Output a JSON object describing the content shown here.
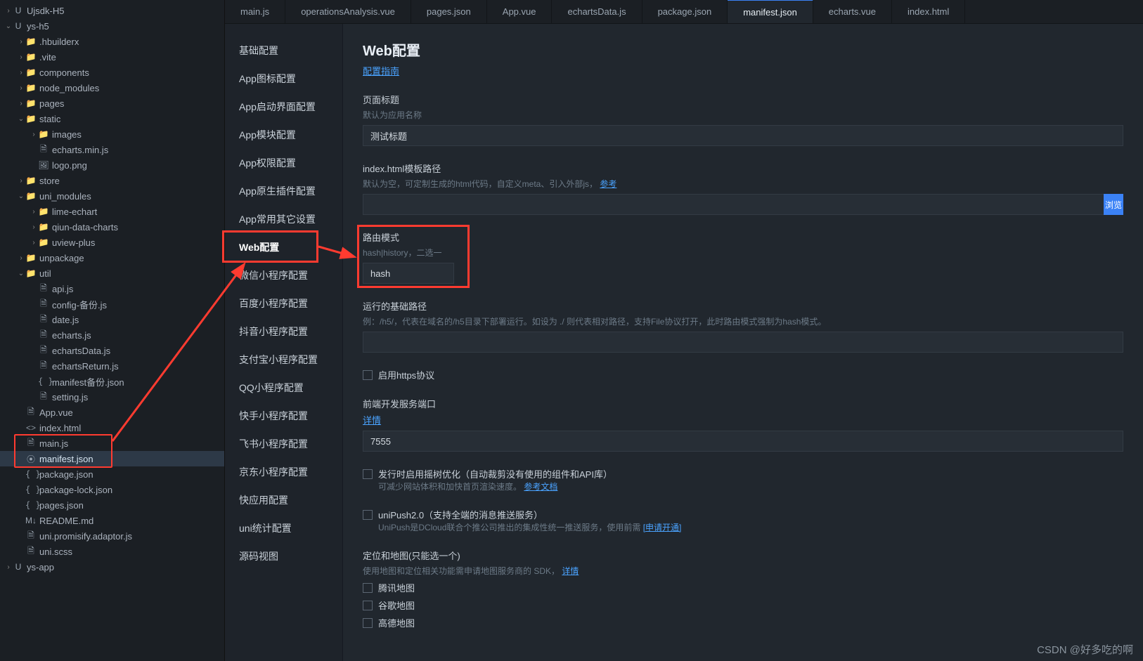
{
  "tabs": [
    {
      "label": "main.js"
    },
    {
      "label": "operationsAnalysis.vue"
    },
    {
      "label": "pages.json"
    },
    {
      "label": "App.vue"
    },
    {
      "label": "echartsData.js"
    },
    {
      "label": "package.json"
    },
    {
      "label": "manifest.json",
      "active": true
    },
    {
      "label": "echarts.vue"
    },
    {
      "label": "index.html"
    }
  ],
  "explorer": {
    "root1": "Ujsdk-H5",
    "root2": "ys-h5",
    "items": [
      {
        "pad": 1,
        "chev": ">",
        "icon": "folder",
        "label": ".hbuilderx"
      },
      {
        "pad": 1,
        "chev": ">",
        "icon": "folder",
        "label": ".vite"
      },
      {
        "pad": 1,
        "chev": ">",
        "icon": "folder",
        "label": "components"
      },
      {
        "pad": 1,
        "chev": ">",
        "icon": "folder",
        "label": "node_modules"
      },
      {
        "pad": 1,
        "chev": ">",
        "icon": "folder",
        "label": "pages"
      },
      {
        "pad": 1,
        "chev": "v",
        "icon": "folder",
        "label": "static"
      },
      {
        "pad": 2,
        "chev": ">",
        "icon": "folder",
        "label": "images"
      },
      {
        "pad": 2,
        "chev": "",
        "icon": "file",
        "label": "echarts.min.js"
      },
      {
        "pad": 2,
        "chev": "",
        "icon": "img",
        "label": "logo.png"
      },
      {
        "pad": 1,
        "chev": ">",
        "icon": "folder",
        "label": "store"
      },
      {
        "pad": 1,
        "chev": "v",
        "icon": "folder",
        "label": "uni_modules"
      },
      {
        "pad": 2,
        "chev": ">",
        "icon": "folder",
        "label": "lime-echart"
      },
      {
        "pad": 2,
        "chev": ">",
        "icon": "folder",
        "label": "qiun-data-charts"
      },
      {
        "pad": 2,
        "chev": ">",
        "icon": "folder",
        "label": "uview-plus"
      },
      {
        "pad": 1,
        "chev": ">",
        "icon": "folder",
        "label": "unpackage"
      },
      {
        "pad": 1,
        "chev": "v",
        "icon": "folder",
        "label": "util"
      },
      {
        "pad": 2,
        "chev": "",
        "icon": "file",
        "label": "api.js"
      },
      {
        "pad": 2,
        "chev": "",
        "icon": "file",
        "label": "config-备份.js"
      },
      {
        "pad": 2,
        "chev": "",
        "icon": "file",
        "label": "date.js"
      },
      {
        "pad": 2,
        "chev": "",
        "icon": "file",
        "label": "echarts.js"
      },
      {
        "pad": 2,
        "chev": "",
        "icon": "file",
        "label": "echartsData.js"
      },
      {
        "pad": 2,
        "chev": "",
        "icon": "file",
        "label": "echartsReturn.js"
      },
      {
        "pad": 2,
        "chev": "",
        "icon": "bracket",
        "label": "manifest备份.json"
      },
      {
        "pad": 2,
        "chev": "",
        "icon": "file",
        "label": "setting.js"
      },
      {
        "pad": 1,
        "chev": "",
        "icon": "file",
        "label": "App.vue"
      },
      {
        "pad": 1,
        "chev": "",
        "icon": "tag",
        "label": "index.html"
      },
      {
        "pad": 1,
        "chev": "",
        "icon": "file",
        "label": "main.js"
      },
      {
        "pad": 1,
        "chev": "",
        "icon": "target",
        "label": "manifest.json",
        "sel": true
      },
      {
        "pad": 1,
        "chev": "",
        "icon": "bracket",
        "label": "package.json"
      },
      {
        "pad": 1,
        "chev": "",
        "icon": "bracket",
        "label": "package-lock.json"
      },
      {
        "pad": 1,
        "chev": "",
        "icon": "bracket",
        "label": "pages.json"
      },
      {
        "pad": 1,
        "chev": "",
        "icon": "md",
        "label": "README.md"
      },
      {
        "pad": 1,
        "chev": "",
        "icon": "file",
        "label": "uni.promisify.adaptor.js"
      },
      {
        "pad": 1,
        "chev": "",
        "icon": "file",
        "label": "uni.scss"
      }
    ],
    "root3": "ys-app"
  },
  "subnav": [
    "基础配置",
    "App图标配置",
    "App启动界面配置",
    "App模块配置",
    "App权限配置",
    "App原生插件配置",
    "App常用其它设置",
    "Web配置",
    "微信小程序配置",
    "百度小程序配置",
    "抖音小程序配置",
    "支付宝小程序配置",
    "QQ小程序配置",
    "快手小程序配置",
    "飞书小程序配置",
    "京东小程序配置",
    "快应用配置",
    "uni统计配置",
    "源码视图"
  ],
  "subnav_active": "Web配置",
  "content": {
    "title": "Web配置",
    "guide": "配置指南",
    "page_title": {
      "label": "页面标题",
      "hint": "默认为应用名称",
      "value": "测试标题"
    },
    "template": {
      "label": "index.html模板路径",
      "hint_pre": "默认为空，可定制生成的html代码，自定义meta、引入外部js，",
      "hint_link": "参考",
      "value": "",
      "browse": "浏览"
    },
    "route": {
      "label": "路由模式",
      "hint": "hash|history，二选一",
      "value": "hash"
    },
    "basepath": {
      "label": "运行的基础路径",
      "hint": "例：/h5/，代表在域名的/h5目录下部署运行。如设为 ./ 则代表相对路径，支持File协议打开，此时路由模式强制为hash模式。",
      "value": ""
    },
    "https": {
      "label": "启用https协议"
    },
    "devport": {
      "label": "前端开发服务端口",
      "link": "详情",
      "value": "7555"
    },
    "treeshake": {
      "label": "发行时启用摇树优化（自动裁剪没有使用的组件和API库）",
      "hint_pre": "可减少网站体积和加快首页渲染速度。",
      "hint_link": "参考文档"
    },
    "unipush": {
      "label": "uniPush2.0（支持全端的消息推送服务）",
      "hint_pre": "UniPush是DCloud联合个推公司推出的集成性统一推送服务，使用前需 ",
      "hint_link": "[申请开通]"
    },
    "maps": {
      "label": "定位和地图(只能选一个)",
      "hint_pre": "使用地图和定位相关功能需申请地图服务商的 SDK，",
      "hint_link": "详情",
      "opt1": "腾讯地图",
      "opt2": "谷歌地图",
      "opt3": "高德地图"
    }
  },
  "watermark": "CSDN @好多吃的啊"
}
